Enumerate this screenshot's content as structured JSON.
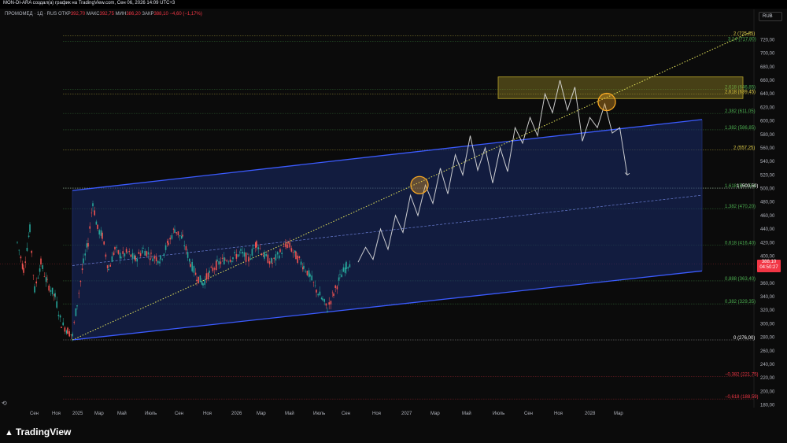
{
  "header": {
    "title": "MON-DI-ARA создал(а) график на TradingView.com, Сен 06, 2026 14:09 UTC+3"
  },
  "legend": {
    "symbol": "ПРОМОМЕД · 1Д · RUS",
    "open_label": "ОТКР",
    "open": "392,70",
    "high_label": "МАКС",
    "high": "392,75",
    "low_label": "МИН",
    "low": "386,20",
    "close_label": "ЗАКР",
    "close": "388,10",
    "change": "−4,60 (−1,17%)"
  },
  "currency_button": "RUB",
  "last_price": {
    "price": "388,10",
    "countdown": "04:50:27",
    "color": "#f23645"
  },
  "brand": "TradingView",
  "colors": {
    "channel_line": "#3b5bff",
    "channel_fill": "#1a2b6b",
    "target_zone": "#b8a42a",
    "dotted_trend": "#e6e65a",
    "circle": "#f5a623",
    "projection": "#e0e0e0",
    "fib_green": "#4caf50",
    "fib_red": "#f23645",
    "fib_yellow": "#e6d34a"
  },
  "chart_data": {
    "type": "candlestick",
    "y_axis": {
      "min": 170,
      "max": 735,
      "ticks": [
        "180,00",
        "200,00",
        "220,00",
        "240,00",
        "260,00",
        "280,00",
        "300,00",
        "320,00",
        "340,00",
        "360,00",
        "380,00",
        "400,00",
        "420,00",
        "440,00",
        "460,00",
        "480,00",
        "500,00",
        "520,00",
        "540,00",
        "560,00",
        "580,00",
        "600,00",
        "620,00",
        "640,00",
        "660,00",
        "680,00",
        "700,00",
        "720,00"
      ]
    },
    "x_axis": {
      "ticks": [
        "Сен",
        "Ноя",
        "2025",
        "Мар",
        "Май",
        "Июль",
        "Сен",
        "Ноя",
        "2026",
        "Мар",
        "Май",
        "Июль",
        "Сен",
        "Ноя",
        "2027",
        "Мар",
        "Май",
        "Июль",
        "Сен",
        "Ноя",
        "2028",
        "Мар"
      ]
    },
    "fib_levels": [
      {
        "label": "3,14 (717,80)",
        "price": 717.8,
        "color": "#4caf50"
      },
      {
        "label": "2 (725,85)",
        "price": 725.85,
        "color": "#e6d34a"
      },
      {
        "label": "2,618 (646,85)",
        "price": 646.85,
        "color": "#4caf50"
      },
      {
        "label": "2,618 (639,45)",
        "price": 639.45,
        "color": "#e6d34a"
      },
      {
        "label": "2,382 (611,05)",
        "price": 611.05,
        "color": "#4caf50"
      },
      {
        "label": "1,382 (586,85)",
        "price": 586.85,
        "color": "#4caf50"
      },
      {
        "label": "2 (557,25)",
        "price": 557.25,
        "color": "#e6d34a"
      },
      {
        "label": "1,618 (500,50)",
        "price": 500.5,
        "color": "#4caf50"
      },
      {
        "label": "1 (500,50)",
        "price": 500.5,
        "color": "#ffffff"
      },
      {
        "label": "1,382 (470,20)",
        "price": 470.2,
        "color": "#4caf50"
      },
      {
        "label": "0,618 (416,40)",
        "price": 416.4,
        "color": "#4caf50"
      },
      {
        "label": "0,888 (363,40)",
        "price": 363.4,
        "color": "#4caf50"
      },
      {
        "label": "0,382 (329,35)",
        "price": 329.35,
        "color": "#4caf50"
      },
      {
        "label": "0 (276,00)",
        "price": 276.0,
        "color": "#ffffff"
      },
      {
        "label": "−0,382 (221,75)",
        "price": 221.75,
        "color": "#f23645"
      },
      {
        "label": "−0,618 (188,59)",
        "price": 188.59,
        "color": "#f23645"
      }
    ],
    "channel": {
      "upper": [
        [
          "2024-12",
          497
        ],
        [
          "2028-08",
          602
        ]
      ],
      "lower": [
        [
          "2024-12",
          276
        ],
        [
          "2028-08",
          378
        ]
      ],
      "mid": [
        [
          "2024-12",
          386
        ],
        [
          "2028-08",
          490
        ]
      ]
    },
    "target_zone": {
      "price_low": 633,
      "price_high": 665
    },
    "projection_path": [
      [
        0,
        391
      ],
      [
        1,
        413
      ],
      [
        2,
        395
      ],
      [
        3,
        440
      ],
      [
        4,
        410
      ],
      [
        5,
        460
      ],
      [
        6,
        435
      ],
      [
        7,
        490
      ],
      [
        8,
        460
      ],
      [
        9,
        505
      ],
      [
        10,
        478
      ],
      [
        11,
        530
      ],
      [
        12,
        492
      ],
      [
        13,
        550
      ],
      [
        14,
        520
      ],
      [
        15,
        578
      ],
      [
        16,
        527
      ],
      [
        17,
        560
      ],
      [
        18,
        508
      ],
      [
        19,
        560
      ],
      [
        20,
        525
      ],
      [
        21,
        590
      ],
      [
        22,
        567
      ],
      [
        23,
        605
      ],
      [
        24,
        578
      ],
      [
        25,
        640
      ],
      [
        26,
        612
      ],
      [
        27,
        660
      ],
      [
        28,
        616
      ],
      [
        29,
        650
      ],
      [
        30,
        570
      ],
      [
        31,
        605
      ],
      [
        32,
        590
      ],
      [
        33,
        625
      ],
      [
        34,
        582
      ],
      [
        35,
        590
      ],
      [
        36,
        520
      ]
    ],
    "markers": [
      {
        "price": 505
      },
      {
        "price": 628
      }
    ]
  }
}
